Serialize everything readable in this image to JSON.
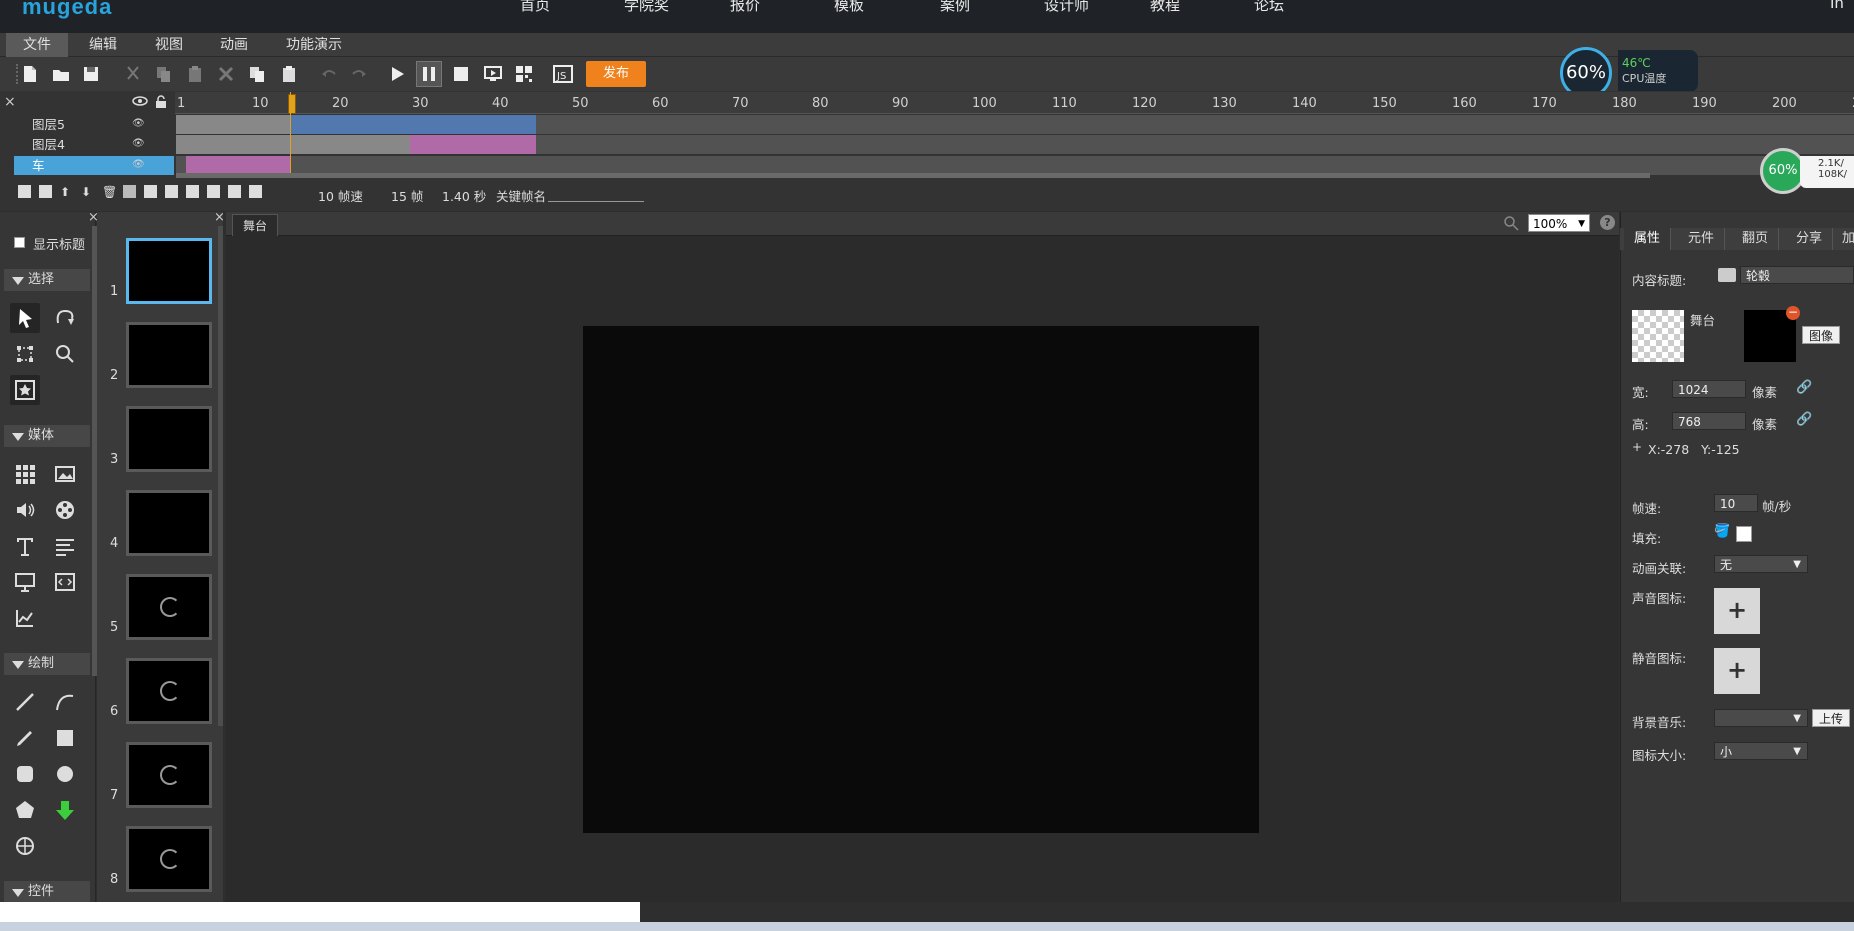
{
  "site_nav": {
    "logo": "mugeda",
    "items": [
      "首页",
      "学院奖",
      "报价",
      "模板",
      "案例",
      "设计师",
      "教程",
      "论坛"
    ],
    "right": "In"
  },
  "menu": [
    "文件",
    "编辑",
    "视图",
    "动画",
    "功能演示"
  ],
  "toolbar": {
    "publish_label": "发布",
    "icons": [
      "new-file-icon",
      "open-folder-icon",
      "save-icon",
      "cut-icon",
      "copy-icon",
      "paste-icon",
      "delete-icon",
      "copy2-icon",
      "paste2-icon",
      "undo-icon",
      "redo-icon",
      "play-icon",
      "pause-icon",
      "stop-icon",
      "preview-icon",
      "qrcode-icon",
      "js-icon"
    ]
  },
  "timeline": {
    "ruler_start": "1",
    "ticks": [
      "10",
      "20",
      "30",
      "40",
      "50",
      "60",
      "70",
      "80",
      "90",
      "100",
      "110",
      "120",
      "130",
      "140",
      "150",
      "160",
      "170",
      "180",
      "190",
      "200",
      "2"
    ],
    "layers": [
      {
        "name": "图层5",
        "selected": false
      },
      {
        "name": "图层4",
        "selected": false
      },
      {
        "name": "车",
        "selected": true
      }
    ],
    "status": {
      "fps": "10 帧速",
      "frames": "15 帧",
      "duration": "1.40 秒",
      "keyframe_label": "关键帧名"
    }
  },
  "widgets": {
    "cpu_percent": "60%",
    "cpu_temp": "46℃",
    "cpu_temp_label": "CPU温度",
    "mem_percent": "60%",
    "net_up": "2.1K/",
    "net_down": "108K/"
  },
  "left_panel": {
    "show_title_label": "显示标题",
    "sections": [
      "选择",
      "媒体",
      "绘制",
      "控件"
    ]
  },
  "thumbnails": [
    "1",
    "2",
    "3",
    "4",
    "5",
    "6",
    "7",
    "8"
  ],
  "stage": {
    "tab_label": "舞台",
    "zoom": "100%",
    "help": "?"
  },
  "props": {
    "tabs": [
      "属性",
      "元件",
      "翻页",
      "分享",
      "加"
    ],
    "content_title_label": "内容标题:",
    "content_title_value": "轮毂",
    "stage_label": "舞台",
    "image_button": "图像",
    "width_label": "宽:",
    "width_value": "1024",
    "height_label": "高:",
    "height_value": "768",
    "unit": "像素",
    "coords": "X:-278   Y:-125",
    "fps_label": "帧速:",
    "fps_value": "10",
    "fps_unit": "帧/秒",
    "fill_label": "填充:",
    "anim_link_label": "动画关联:",
    "anim_link_value": "无",
    "sound_icon_label": "声音图标:",
    "mute_icon_label": "静音图标:",
    "plus": "+",
    "bg_music_label": "背景音乐:",
    "upload_button": "上传",
    "icon_size_label": "图标大小:",
    "icon_size_value": "小"
  }
}
